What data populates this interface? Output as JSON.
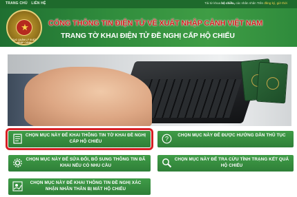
{
  "topbar": {
    "nav": [
      "TRANG CHỦ",
      "LIÊN HỆ"
    ],
    "note_prefix": "Tài từ khoa",
    "note_bold": "bộ chiều,",
    "note_mid": "các nhân nhân Trên",
    "note_link": "đăng ký, giờ thời"
  },
  "header": {
    "emblem_text": "CỤC QUẢN LÝ XUẤT NHẬP CẢNH",
    "title": "CỔNG THÔNG TIN ĐIỆN TỬ VỀ XUẤT NHẬP CẢNH VIỆT NAM",
    "subtitle": "TRANG TỜ KHAI ĐIỆN TỬ ĐỀ NGHỊ CẤP HỘ CHIẾU"
  },
  "buttons": {
    "declare": {
      "label": "CHỌN MỤC NÀY ĐỂ KHAI THÔNG TIN TỜ KHAI ĐỀ NGHỊ CẤP HỘ CHIẾU",
      "icon": "form-icon",
      "highlighted": true
    },
    "guide": {
      "label": "CHỌN MỤC NÀY ĐỂ ĐƯỢC HƯỚNG DẪN THỦ TỤC",
      "icon": "question-icon"
    },
    "edit": {
      "label": "CHỌN MỤC NÀY ĐỂ SỬA ĐỔI, BỔ SUNG THÔNG TIN ĐÃ KHAI NẾU CÓ NHU CẦU",
      "icon": "gear-icon"
    },
    "lookup": {
      "label": "CHỌN MỤC NÀY ĐỂ TRA CỨU TÌNH TRẠNG KẾT QUẢ HỘ CHIẾU",
      "icon": "search-icon"
    },
    "lost": {
      "label": "CHỌN MỤC NÀY ĐỂ KHAI THÔNG TIN ĐỀ NGHỊ XÁC NHẬN NHÂN THÂN BỊ MẤT HỘ CHIẾU",
      "icon": "person-edit-icon"
    }
  },
  "colors": {
    "primary_green": "#2f7f38",
    "highlight_red": "#d61f24",
    "title_red": "#d21f1f"
  }
}
